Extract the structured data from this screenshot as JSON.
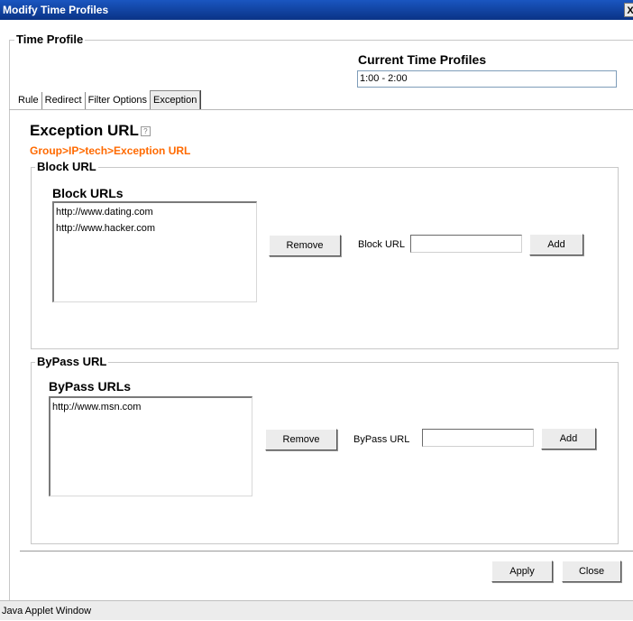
{
  "window": {
    "title": "Modify Time Profiles",
    "close_glyph": "X",
    "status": "Java Applet Window"
  },
  "profile": {
    "section_title": "Time Profile",
    "current_label": "Current Time Profiles",
    "current_value": "1:00 - 2:00"
  },
  "tabs": [
    {
      "label": "Rule",
      "active": false
    },
    {
      "label": "Redirect",
      "active": false
    },
    {
      "label": "Filter Options",
      "active": false
    },
    {
      "label": "Exception",
      "active": true
    }
  ],
  "exception": {
    "title": "Exception URL",
    "help_glyph": "?",
    "breadcrumb": "Group>IP>tech>Exception URL"
  },
  "block": {
    "legend": "Block URL",
    "list_label": "Block URLs",
    "items": [
      "http://www.dating.com",
      "http://www.hacker.com"
    ],
    "remove_label": "Remove",
    "input_label": "Block URL",
    "input_value": "",
    "add_label": "Add"
  },
  "bypass": {
    "legend": "ByPass URL",
    "list_label": "ByPass URLs",
    "items": [
      "http://www.msn.com"
    ],
    "remove_label": "Remove",
    "input_label": "ByPass URL",
    "input_value": "",
    "add_label": "Add"
  },
  "footer": {
    "apply_label": "Apply",
    "close_label": "Close"
  }
}
